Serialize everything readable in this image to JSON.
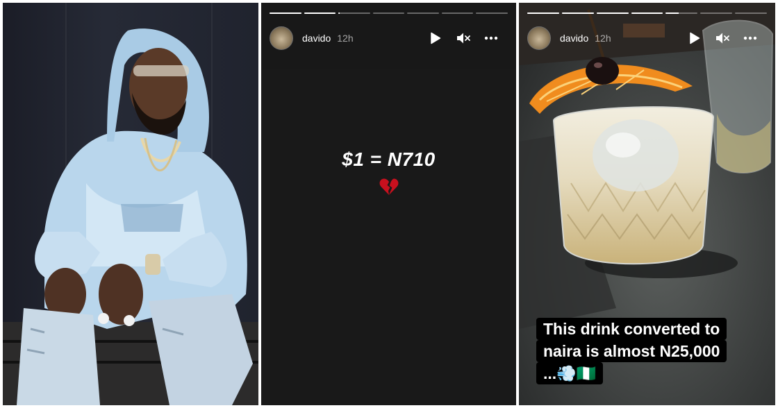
{
  "story": {
    "username": "davido",
    "time": "12h",
    "controls": {
      "play_icon": "play-icon",
      "mute_icon": "speaker-muted-icon",
      "more_icon": "more-horizontal-icon"
    }
  },
  "story1": {
    "progress": [
      1,
      1,
      0.05,
      0,
      0,
      0,
      0
    ],
    "rate_text": "$1 = N710",
    "emoji": "broken-heart",
    "bg": "#191919"
  },
  "story2": {
    "progress": [
      1,
      1,
      1,
      1,
      0.4,
      0,
      0
    ],
    "caption_lines": [
      "This drink converted to",
      "naira is almost N25,000",
      "...💨🇳🇬"
    ]
  },
  "colors": {
    "caption_bg": "#000000",
    "heart": "#c8101e",
    "orange": "#f08c1e"
  }
}
